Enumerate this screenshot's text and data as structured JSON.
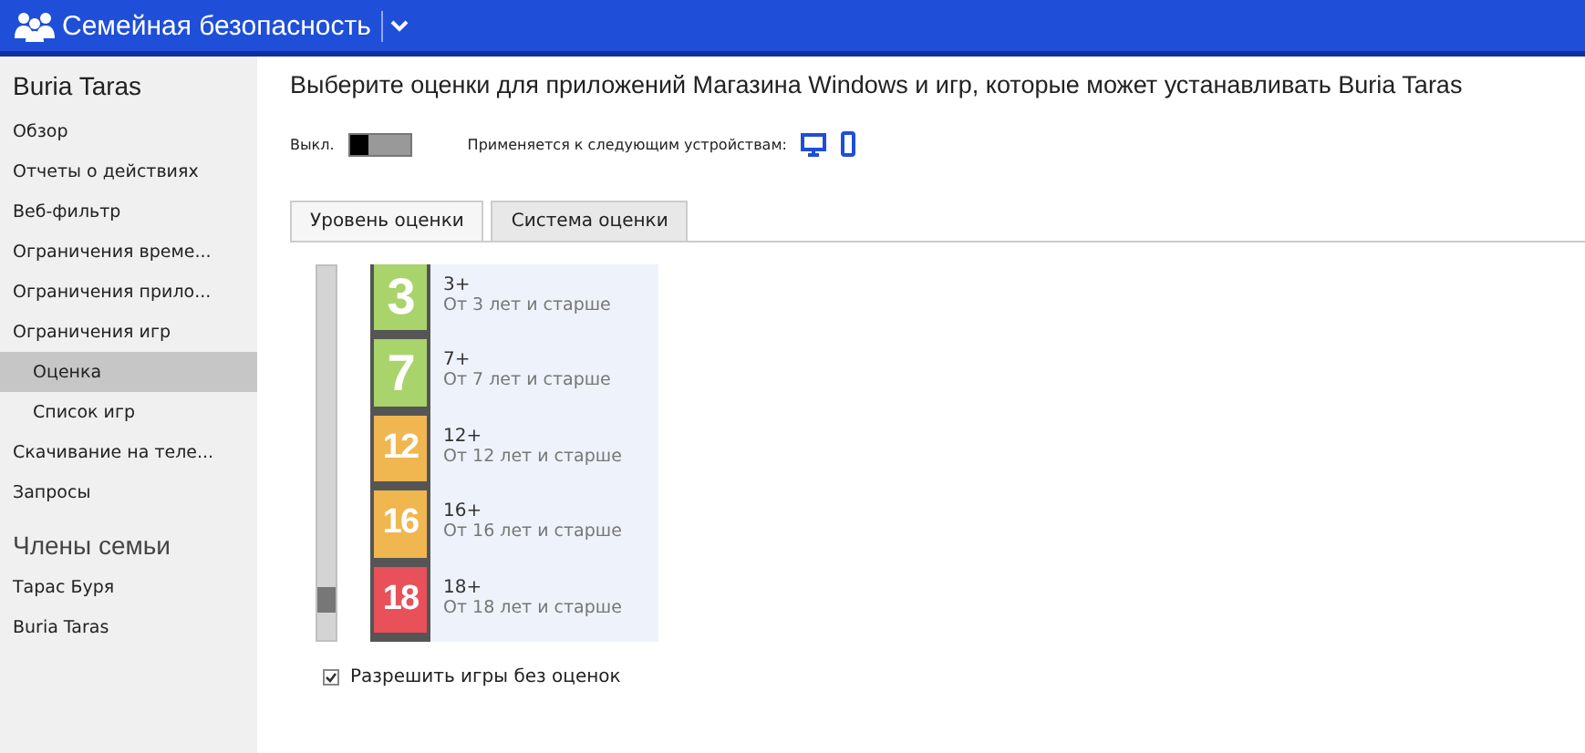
{
  "header": {
    "title": "Семейная безопасность"
  },
  "sidebar": {
    "user": "Buria Taras",
    "items": [
      {
        "label": "Обзор",
        "selected": false
      },
      {
        "label": "Отчеты о действиях",
        "selected": false
      },
      {
        "label": "Веб-фильтр",
        "selected": false
      },
      {
        "label": "Ограничения време...",
        "selected": false
      },
      {
        "label": "Ограничения прило...",
        "selected": false
      },
      {
        "label": "Ограничения игр",
        "selected": false,
        "children": [
          {
            "label": "Оценка",
            "selected": true
          },
          {
            "label": "Список игр",
            "selected": false
          }
        ]
      },
      {
        "label": "Скачивание на теле...",
        "selected": false
      },
      {
        "label": "Запросы",
        "selected": false
      }
    ],
    "family_heading": "Члены семьи",
    "family": [
      {
        "label": "Тарас Буря"
      },
      {
        "label": "Buria Taras"
      }
    ]
  },
  "main": {
    "heading": "Выберите оценки для приложений Магазина Windows и игр, которые может устанавливать Buria Taras",
    "toggle": {
      "label": "Выкл.",
      "on": false
    },
    "devices_label": "Применяется к следующим устройствам:",
    "tabs": [
      {
        "label": "Уровень оценки",
        "selected": true
      },
      {
        "label": "Система оценки",
        "selected": false
      }
    ],
    "ratings": [
      {
        "badge": "3",
        "color": "#a9d36b",
        "title": "3+",
        "subtitle": "От 3 лет и старше"
      },
      {
        "badge": "7",
        "color": "#a9d36b",
        "title": "7+",
        "subtitle": "От 7 лет и старше"
      },
      {
        "badge": "12",
        "color": "#f0b650",
        "title": "12+",
        "subtitle": "От 12 лет и старше"
      },
      {
        "badge": "16",
        "color": "#f0b650",
        "title": "16+",
        "subtitle": "От 16 лет и старше"
      },
      {
        "badge": "18",
        "color": "#e8505a",
        "title": "18+",
        "subtitle": "От 18 лет и старше"
      }
    ],
    "allow_unrated": {
      "label": "Разрешить игры без оценок",
      "checked": true
    }
  }
}
